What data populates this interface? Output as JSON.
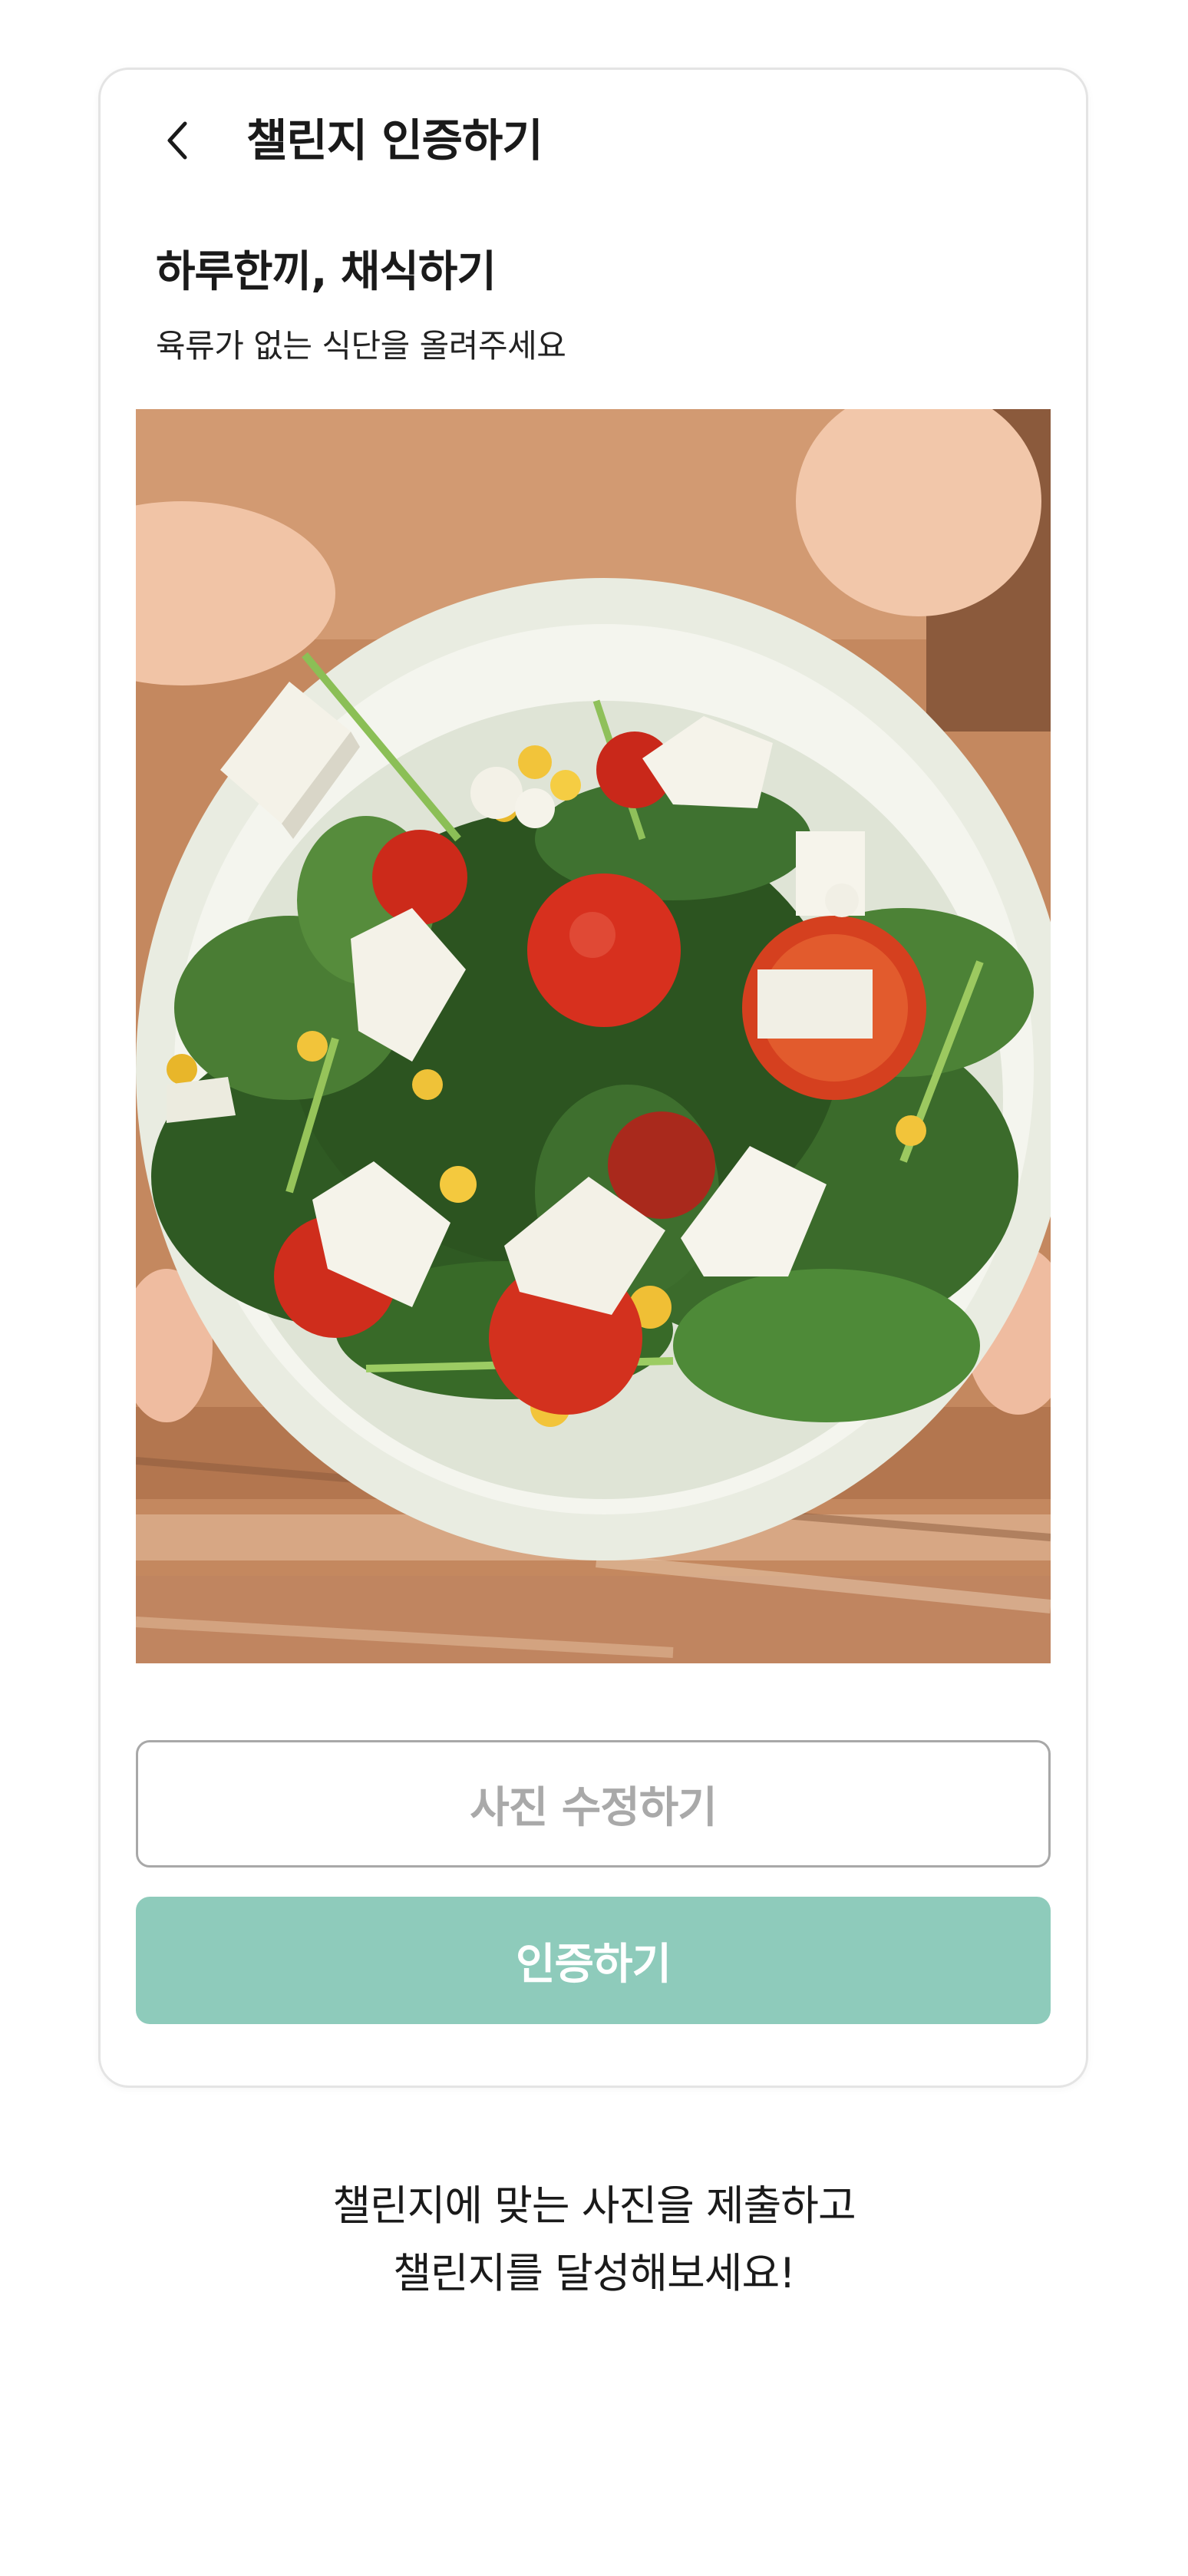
{
  "header": {
    "title": "챌린지 인증하기",
    "back_icon": "chevron-left-icon"
  },
  "challenge": {
    "title": "하루한끼, 채식하기",
    "subtitle": "육류가 없는 식단을 올려주세요"
  },
  "photo": {
    "subject": "spinach salad with tofu, cherry tomatoes and corn"
  },
  "buttons": {
    "edit_label": "사진 수정하기",
    "submit_label": "인증하기"
  },
  "footer": {
    "line1": "챌린지에 맞는 사진을 제출하고",
    "line2": "챌린지를 달성해보세요!"
  },
  "colors": {
    "accent": "#8ecbbb",
    "border": "#a8a8a8",
    "muted_text": "#a9a9a9"
  }
}
